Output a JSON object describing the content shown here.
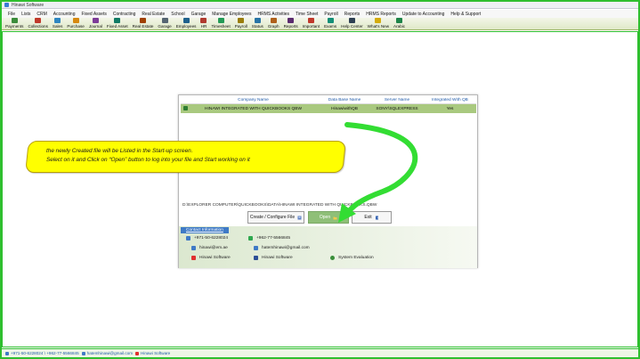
{
  "window": {
    "title": "Hinawi Software"
  },
  "menubar": [
    "File",
    "Lists",
    "CRM",
    "Accounting",
    "Fixed Assets",
    "Contracting",
    "Real Estate",
    "School",
    "Garage",
    "Manage Employees",
    "HRMS Activities",
    "Time Sheet",
    "Payroll",
    "Reports",
    "HRMS Reports",
    "Update to Accounting",
    "Help & Support"
  ],
  "toolbar": [
    {
      "label": "Payments",
      "color": "#3b8c3b"
    },
    {
      "label": "Collections",
      "color": "#c0392b"
    },
    {
      "label": "Sales",
      "color": "#2e86c1"
    },
    {
      "label": "Purchase",
      "color": "#d68910"
    },
    {
      "label": "Journal",
      "color": "#7d3c98"
    },
    {
      "label": "Fixed Asset",
      "color": "#117a65"
    },
    {
      "label": "Real Estate",
      "color": "#a04000"
    },
    {
      "label": "Garage",
      "color": "#566573"
    },
    {
      "label": "Employees",
      "color": "#1f618d"
    },
    {
      "label": "HR",
      "color": "#b03a2e"
    },
    {
      "label": "Timesheet",
      "color": "#239b56"
    },
    {
      "label": "Payroll",
      "color": "#9a7d0a"
    },
    {
      "label": "Status",
      "color": "#2874a6"
    },
    {
      "label": "Graph",
      "color": "#af601a"
    },
    {
      "label": "Reports",
      "color": "#5b2c6f"
    },
    {
      "label": "Important",
      "color": "#c0392b"
    },
    {
      "label": "Exams",
      "color": "#148f77"
    },
    {
      "label": "Help Center",
      "color": "#2e4053"
    },
    {
      "label": "What's New",
      "color": "#d4ac0d"
    },
    {
      "label": "Arabic",
      "color": "#1e8449"
    }
  ],
  "dialog": {
    "columns": [
      "Company Name",
      "Data Base Name",
      "Server Name",
      "Integrated With QB"
    ],
    "rows": [
      {
        "company": "HINAWI INTEGRATED WITH QUICKBOOKS QBW",
        "database": "HinawiwithQB",
        "server": "SONY\\SQLEXPRESS",
        "integrated": "Yes"
      }
    ],
    "file_path": "D:\\EXPLORER COMPUTER\\QUICKBOOKS\\DATA\\HINAWI INTEGRATED WITH QUICKBOOKS.QBW",
    "buttons": {
      "create": "Create / Configure File",
      "open": "Open",
      "exit": "Exit"
    },
    "contact": {
      "tab": "Contact Information",
      "phone1": "+971-50-6228024",
      "phone2": "+962-77-5566845",
      "email1": "hinawi@em.ae",
      "email2": "hatemhinawi@gmail.com",
      "youtube": "Hinawi Software",
      "facebook": "Hinawi Software",
      "system": "System Evaluation"
    }
  },
  "callout": {
    "line1": "the newly Created file will be Listed in the Start-up screen.",
    "line2": "Select on it and Click on “Open” button to log into your file and Start working on it"
  },
  "statusbar": {
    "phones": "+971-50-6228024 \\ +962-77-5566845",
    "email": "hatemhinawi@gmail.com",
    "youtube": "Hinawi Software"
  },
  "colors": {
    "frame": "#2fbf2f",
    "selected_row": "#a9c97f",
    "callout": "#ffff00",
    "arrow": "#33dd33",
    "contact_tab": "#3f7ac6"
  }
}
